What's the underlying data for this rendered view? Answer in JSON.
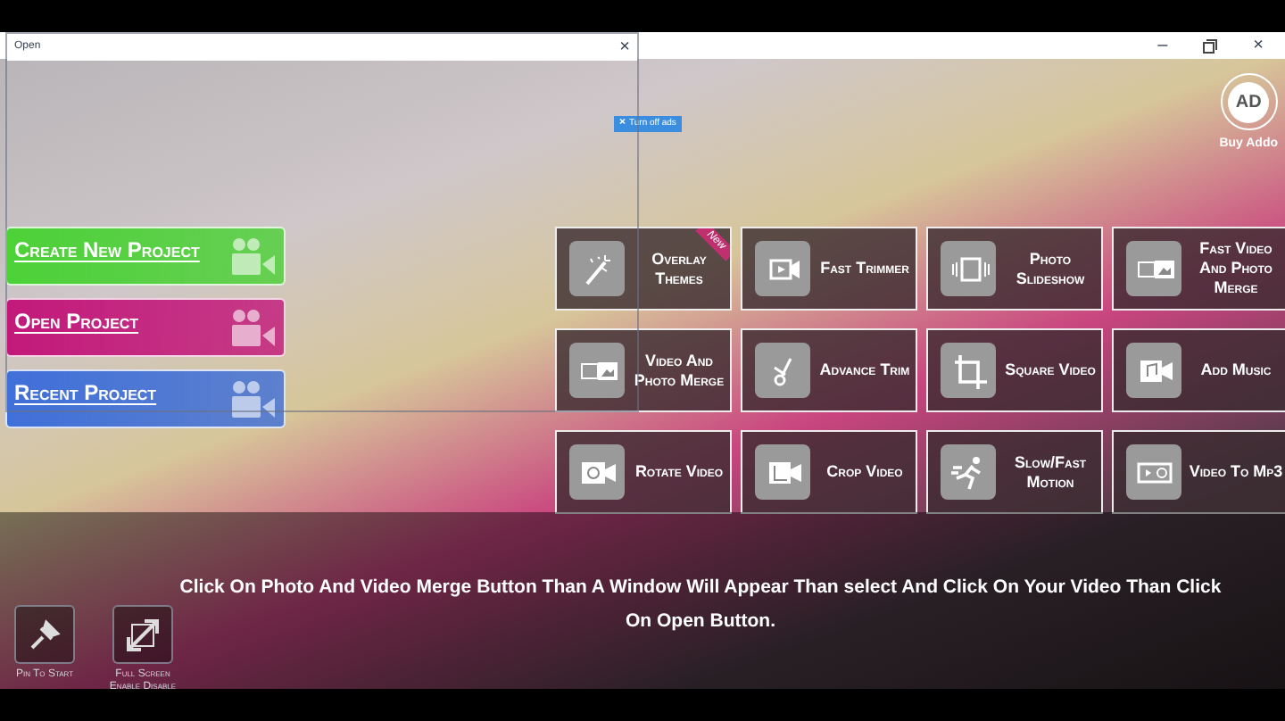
{
  "dialog": {
    "title": "Open",
    "close": "×"
  },
  "ad_badge": {
    "close": "×",
    "label": "Turn off ads"
  },
  "window_controls": {
    "minimize": "–",
    "close": "×"
  },
  "addons": {
    "logo": "AD",
    "label": "Buy Addo"
  },
  "projects": [
    {
      "label": "Create New Project",
      "color": "#4cd137"
    },
    {
      "label": "Open Project",
      "color": "#c2187a"
    },
    {
      "label": "Recent Project",
      "color": "#3f6fd8"
    }
  ],
  "tools": [
    {
      "label": "Overlay Themes",
      "kind": "wand",
      "badge": "New"
    },
    {
      "label": "Fast Trimmer",
      "kind": "film"
    },
    {
      "label": "Photo Slideshow",
      "kind": "slides"
    },
    {
      "label": "Fast Video And Photo Merge",
      "kind": "merge"
    },
    {
      "label": "Video And Photo Merge",
      "kind": "merge"
    },
    {
      "label": "Advance Trim",
      "kind": "scissors"
    },
    {
      "label": "Square Video",
      "kind": "crop"
    },
    {
      "label": "Add Music",
      "kind": "music"
    },
    {
      "label": "Rotate Video",
      "kind": "rotate"
    },
    {
      "label": "Crop Video",
      "kind": "cropcam"
    },
    {
      "label": "Slow/Fast Motion",
      "kind": "runner"
    },
    {
      "label": "Video To Mp3",
      "kind": "audio"
    }
  ],
  "caption": "Click On Photo And Video Merge Button Than A Window Will Appear Than select And Click On Your Video Than Click On Open Button.",
  "bottom_buttons": [
    {
      "label": "Pin To Start",
      "kind": "pin"
    },
    {
      "label": "Full Screen Enable Disable",
      "kind": "fullscreen"
    }
  ]
}
